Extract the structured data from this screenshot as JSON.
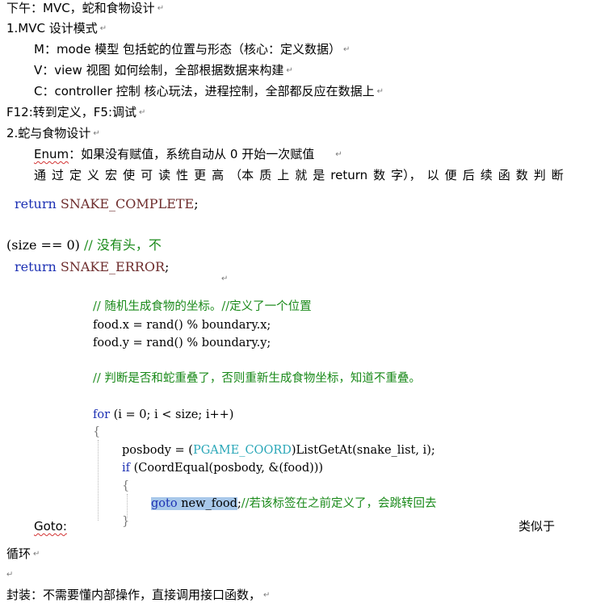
{
  "notes": {
    "title": "下午：MVC，蛇和食物设计",
    "mvc_heading": "1.MVC 设计模式",
    "mvc_m": "M：mode 模型 包括蛇的位置与形态（核心：定义数据）",
    "mvc_v": "V：view 视图 如何绘制，全部根据数据来构建",
    "mvc_c": "C：controller 控制 核心玩法，进程控制，全部都反应在数据上",
    "hotkeys": "F12:转到定义，F5:调试",
    "design_heading": "2.蛇与食物设计",
    "enum_word": "Enum",
    "enum_rest": "：如果没有赋值，系统自动从 0 开始一次赋值",
    "macro_parts": [
      "通",
      "过",
      "定",
      "义",
      "宏",
      "使",
      "可",
      "读",
      "性",
      "更",
      "高",
      "（本",
      "质",
      "上",
      "就",
      "是",
      "return",
      "数",
      "字），",
      "以",
      "便",
      "后",
      "续",
      "函",
      "数",
      "判",
      "断"
    ],
    "goto_word": "Goto:",
    "goto_tail": "类似于",
    "loop": "循环",
    "encap": "封装：不需要懂内部操作，直接调用接口函数，"
  },
  "code": {
    "ret_kw": "return",
    "ret_complete": "SNAKE_COMPLETE",
    "semi": ";",
    "if_cond": "(size == 0)",
    "if_comment": "// 没有头，不",
    "ret_error": "SNAKE_ERROR",
    "c_rand": "// 随机生成食物的坐标。//定义了一个位置",
    "food_x": "food.x = rand() % boundary.x;",
    "food_y": "food.y = rand() % boundary.y;",
    "c_overlap": "// 判断是否和蛇重叠了，否则重新生成食物坐标，知道不重叠。",
    "for_kw": "for",
    "for_rest": " (i = 0; i < size; i++)",
    "brace_open": "{",
    "brace_close": "}",
    "pos_a": "posbody = (",
    "pos_type": "PGAME_COORD",
    "pos_b": ")ListGetAt(snake_list, i);",
    "if_kw": "if",
    "if_rest": " (CoordEqual(posbody, &(food)))",
    "goto_kw": "goto",
    "goto_label": "new_food",
    "goto_comment": "//若该标签在之前定义了，会跳转回去"
  }
}
